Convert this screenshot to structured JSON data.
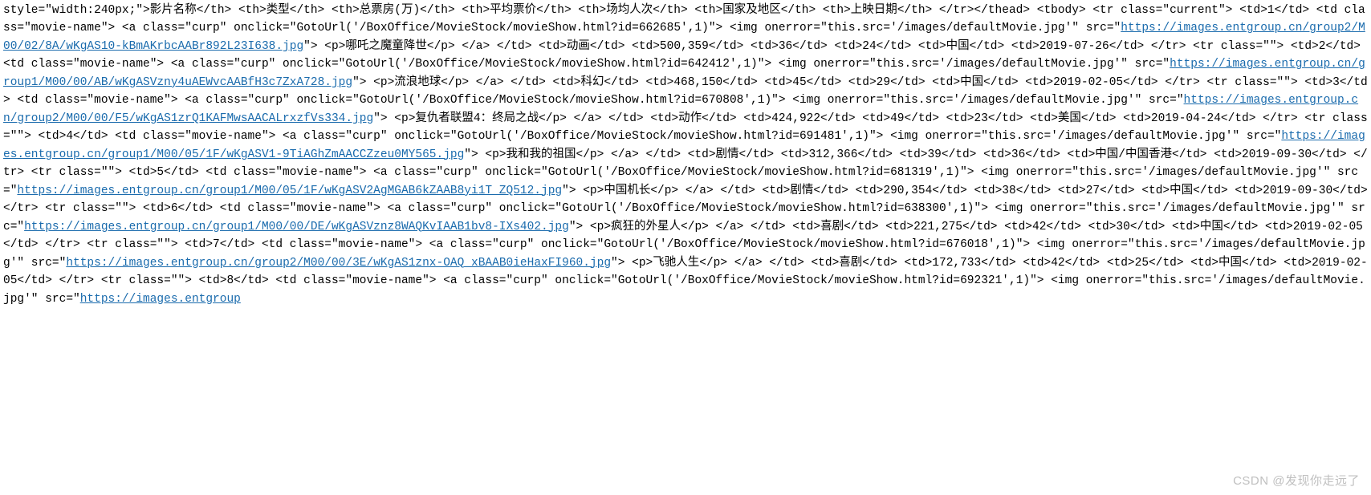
{
  "watermark": "CSDN @发现你走远了",
  "segments": [
    "style=\"width:240px;\">影片名称</th>  <th>类型</th>  <th>总票房(万)</th>  <th>平均票价</th>  <th>场均人次</th>  <th>国家及地区</th>  <th>上映日期</th> </tr></thead>  <tbody>  <tr class=\"current\">  <td>1</td>  <td class=\"movie-name\">  <a class=\"curp\" onclick=\"GotoUrl('/BoxOffice/MovieStock/movieShow.html?id=662685',1)\">  <img onerror=\"this.src='/images/defaultMovie.jpg'\" src=\"",
    "\">  <p>哪吒之魔童降世</p>  </a>  </td>  <td>动画</td>  <td>500,359</td>  <td>36</td>  <td>24</td>  <td>中国</td>  <td>2019-07-26</td>  </tr>   <tr class=\"\">  <td>2</td>  <td class=\"movie-name\">  <a class=\"curp\" onclick=\"GotoUrl('/BoxOffice/MovieStock/movieShow.html?id=642412',1)\">  <img onerror=\"this.src='/images/defaultMovie.jpg'\" src=\"",
    "\">  <p>流浪地球</p>  </a>  </td>  <td>科幻</td>  <td>468,150</td>  <td>45</td>  <td>29</td>  <td>中国</td>  <td>2019-02-05</td>  </tr>   <tr class=\"\">  <td>3</td>  <td class=\"movie-name\">  <a class=\"curp\" onclick=\"GotoUrl('/BoxOffice/MovieStock/movieShow.html?id=670808',1)\">  <img onerror=\"this.src='/images/defaultMovie.jpg'\" src=\"",
    "\">  <p>复仇者联盟4：终局之战</p>  </a>  </td>  <td>动作</td>  <td>424,922</td>  <td>49</td>  <td>23</td>  <td>美国</td>  <td>2019-04-24</td>  </tr>   <tr class=\"\">  <td>4</td>  <td class=\"movie-name\">  <a class=\"curp\" onclick=\"GotoUrl('/BoxOffice/MovieStock/movieShow.html?id=691481',1)\">  <img onerror=\"this.src='/images/defaultMovie.jpg'\" src=\"",
    "\">  <p>我和我的祖国</p>  </a>  </td>  <td>剧情</td>  <td>312,366</td>  <td>39</td>  <td>36</td>  <td>中国/中国香港</td>  <td>2019-09-30</td>  </tr>   <tr class=\"\">  <td>5</td>  <td class=\"movie-name\">  <a class=\"curp\" onclick=\"GotoUrl('/BoxOffice/MovieStock/movieShow.html?id=681319',1)\">  <img onerror=\"this.src='/images/defaultMovie.jpg'\" src=\"",
    "\">  <p>中国机长</p>  </a>  </td>  <td>剧情</td>  <td>290,354</td>  <td>38</td>  <td>27</td>  <td>中国</td>  <td>2019-09-30</td>  </tr>   <tr class=\"\">  <td>6</td>  <td class=\"movie-name\">  <a class=\"curp\" onclick=\"GotoUrl('/BoxOffice/MovieStock/movieShow.html?id=638300',1)\">  <img onerror=\"this.src='/images/defaultMovie.jpg'\" src=\"",
    "\">  <p>疯狂的外星人</p>  </a>  </td>  <td>喜剧</td>  <td>221,275</td>  <td>42</td>  <td>30</td>  <td>中国</td>  <td>2019-02-05</td>  </tr>   <tr class=\"\">  <td>7</td>  <td class=\"movie-name\">  <a class=\"curp\" onclick=\"GotoUrl('/BoxOffice/MovieStock/movieShow.html?id=676018',1)\">  <img onerror=\"this.src='/images/defaultMovie.jpg'\" src=\"",
    "\">  <p>飞驰人生</p>  </a>  </td>  <td>喜剧</td>  <td>172,733</td>  <td>42</td>  <td>25</td>  <td>中国</td>  <td>2019-02-05</td>  </tr>   <tr class=\"\">  <td>8</td>  <td class=\"movie-name\">  <a class=\"curp\" onclick=\"GotoUrl('/BoxOffice/MovieStock/movieShow.html?id=692321',1)\">  <img onerror=\"this.src='/images/defaultMovie.jpg'\" src=\""
  ],
  "links": [
    "https://images.entgroup.cn/group2/M00/02/8A/wKgAS10-kBmAKrbcAABr892L23I638.jpg",
    "https://images.entgroup.cn/group1/M00/00/AB/wKgASVzny4uAEWvcAABfH3c7ZxA728.jpg",
    "https://images.entgroup.cn/group2/M00/00/F5/wKgAS1zrQ1KAFMwsAACALrxzfVs334.jpg",
    "https://images.entgroup.cn/group1/M00/05/1F/wKgASV1-9TiAGhZmAACCZzeu0MY565.jpg",
    "https://images.entgroup.cn/group1/M00/05/1F/wKgASV2AgMGAB6kZAAB8yi1T_ZQ512.jpg",
    "https://images.entgroup.cn/group1/M00/00/DE/wKgASVznz8WAQKvIAAB1bv8-IXs402.jpg",
    "https://images.entgroup.cn/group2/M00/00/3E/wKgAS1znx-OAQ_xBAAB0ieHaxFI960.jpg",
    "https://images.entgroup"
  ]
}
